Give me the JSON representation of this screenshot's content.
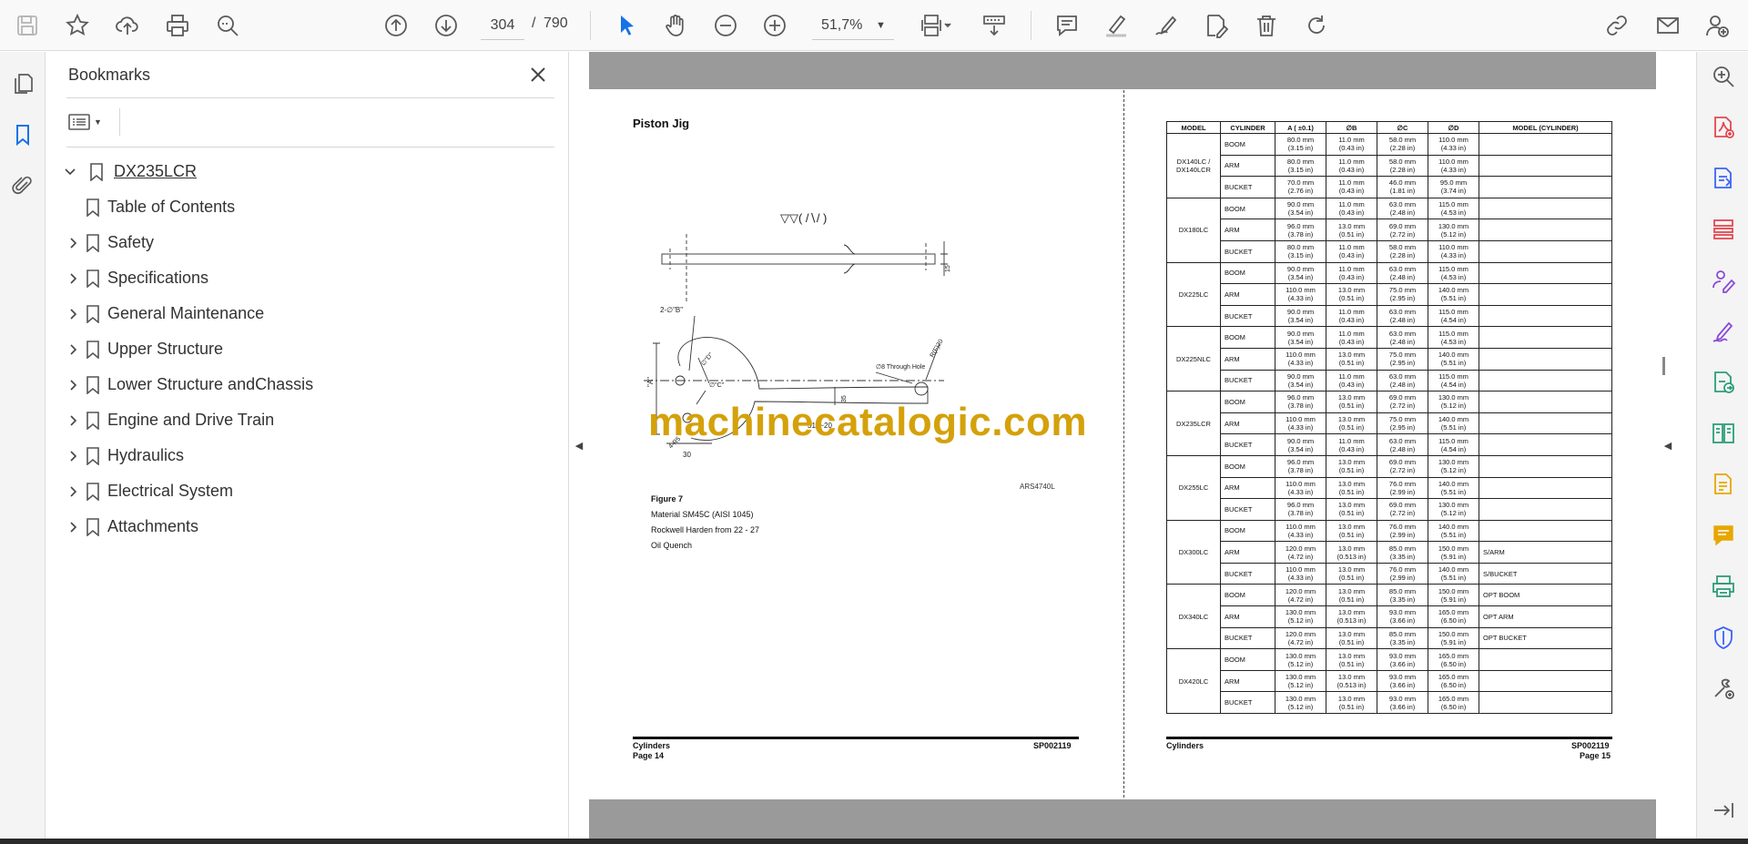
{
  "toolbar": {
    "current_page": "304",
    "page_separator": "/",
    "total_pages": "790",
    "zoom": "51,7%"
  },
  "bookmarks": {
    "title": "Bookmarks",
    "root": "DX235LCR",
    "items": [
      {
        "label": "Table of Contents",
        "expandable": false
      },
      {
        "label": "Safety",
        "expandable": true
      },
      {
        "label": "Specifications",
        "expandable": true
      },
      {
        "label": "General Maintenance",
        "expandable": true
      },
      {
        "label": "Upper Structure",
        "expandable": true
      },
      {
        "label": "Lower Structure andChassis",
        "expandable": true
      },
      {
        "label": "Engine and Drive Train",
        "expandable": true
      },
      {
        "label": "Hydraulics",
        "expandable": true
      },
      {
        "label": "Electrical System",
        "expandable": true
      },
      {
        "label": "Attachments",
        "expandable": true
      }
    ]
  },
  "left_page": {
    "title": "Piston Jig",
    "figure_code": "ARS4740L",
    "figure_caption": "Figure 7",
    "material": "Material SM45C (AISI 1045)",
    "hardness": "Rockwell Harden from 22 - 27",
    "quench": "Oil Quench",
    "dims": {
      "surface": "▽▽( /∖/ )",
      "holes": "2-∅\"B\"",
      "through_hole": "∅8 Through Hole",
      "radius": "R(F)20",
      "a": "\"A\"",
      "c": "∅\"C\"",
      "d": "∅\"D\"",
      "w35": "35",
      "len": "315~20",
      "w30": "30",
      "r5": "4-R5",
      "t15": "15"
    },
    "footer_left": "Cylinders",
    "footer_page": "Page 14",
    "footer_right": "SP002119"
  },
  "watermark": "machinecatalogic.com",
  "right_page": {
    "footer_left": "Cylinders",
    "footer_right": "SP002119",
    "footer_page": "Page 15",
    "table": {
      "headers": [
        "MODEL",
        "CYLINDER",
        "A ( ±0.1)",
        "∅B",
        "∅C",
        "∅D",
        "MODEL (CYLINDER)"
      ],
      "groups": [
        {
          "model": "DX140LC / DX140LCR",
          "rows": [
            {
              "cyl": "BOOM",
              "a": "80.0 mm\n(3.15 in)",
              "b": "11.0 mm\n(0.43 in)",
              "c": "58.0 mm\n(2.28 in)",
              "d": "110.0 mm\n(4.33 in)",
              "mc": ""
            },
            {
              "cyl": "ARM",
              "a": "80.0 mm\n(3.15 in)",
              "b": "11.0 mm\n(0.43 in)",
              "c": "58.0 mm\n(2.28 in)",
              "d": "110.0 mm\n(4.33 in)",
              "mc": ""
            },
            {
              "cyl": "BUCKET",
              "a": "70.0 mm\n(2.76 in)",
              "b": "11.0 mm\n(0.43 in)",
              "c": "46.0 mm\n(1.81 in)",
              "d": "95.0 mm\n(3.74 in)",
              "mc": ""
            }
          ]
        },
        {
          "model": "DX180LC",
          "rows": [
            {
              "cyl": "BOOM",
              "a": "90.0 mm\n(3.54 in)",
              "b": "11.0 mm\n(0.43 in)",
              "c": "63.0 mm\n(2.48 in)",
              "d": "115.0 mm\n(4.53 in)",
              "mc": ""
            },
            {
              "cyl": "ARM",
              "a": "96.0 mm\n(3.78 in)",
              "b": "13.0 mm\n(0.51 in)",
              "c": "69.0 mm\n(2.72 in)",
              "d": "130.0 mm\n(5.12 in)",
              "mc": ""
            },
            {
              "cyl": "BUCKET",
              "a": "80.0 mm\n(3.15 in)",
              "b": "11.0 mm\n(0.43 in)",
              "c": "58.0 mm\n(2.28 in)",
              "d": "110.0 mm\n(4.33 in)",
              "mc": ""
            }
          ]
        },
        {
          "model": "DX225LC",
          "rows": [
            {
              "cyl": "BOOM",
              "a": "90.0 mm\n(3.54 in)",
              "b": "11.0 mm\n(0.43 in)",
              "c": "63.0 mm\n(2.48 in)",
              "d": "115.0 mm\n(4.53 in)",
              "mc": ""
            },
            {
              "cyl": "ARM",
              "a": "110.0 mm\n(4.33 in)",
              "b": "13.0 mm\n(0.51 in)",
              "c": "75.0 mm\n(2.95 in)",
              "d": "140.0 mm\n(5.51 in)",
              "mc": ""
            },
            {
              "cyl": "BUCKET",
              "a": "90.0 mm\n(3.54 in)",
              "b": "11.0 mm\n(0.43 in)",
              "c": "63.0 mm\n(2.48 in)",
              "d": "115.0 mm\n(4.54 in)",
              "mc": ""
            }
          ]
        },
        {
          "model": "DX225NLC",
          "rows": [
            {
              "cyl": "BOOM",
              "a": "90.0 mm\n(3.54 in)",
              "b": "11.0 mm\n(0.43 in)",
              "c": "63.0 mm\n(2.48 in)",
              "d": "115.0 mm\n(4.53 in)",
              "mc": ""
            },
            {
              "cyl": "ARM",
              "a": "110.0 mm\n(4.33 in)",
              "b": "13.0 mm\n(0.51 in)",
              "c": "75.0 mm\n(2.95 in)",
              "d": "140.0 mm\n(5.51 in)",
              "mc": ""
            },
            {
              "cyl": "BUCKET",
              "a": "90.0 mm\n(3.54 in)",
              "b": "11.0 mm\n(0.43 in)",
              "c": "63.0 mm\n(2.48 in)",
              "d": "115.0 mm\n(4.54 in)",
              "mc": ""
            }
          ]
        },
        {
          "model": "DX235LCR",
          "rows": [
            {
              "cyl": "BOOM",
              "a": "96.0 mm\n(3.78 in)",
              "b": "13.0 mm\n(0.51 in)",
              "c": "69.0 mm\n(2.72 in)",
              "d": "130.0 mm\n(5.12 in)",
              "mc": ""
            },
            {
              "cyl": "ARM",
              "a": "110.0 mm\n(4.33 in)",
              "b": "13.0 mm\n(0.51 in)",
              "c": "75.0 mm\n(2.95 in)",
              "d": "140.0 mm\n(5.51 in)",
              "mc": ""
            },
            {
              "cyl": "BUCKET",
              "a": "90.0 mm\n(3.54 in)",
              "b": "11.0 mm\n(0.43 in)",
              "c": "63.0 mm\n(2.48 in)",
              "d": "115.0 mm\n(4.54 in)",
              "mc": ""
            }
          ]
        },
        {
          "model": "DX255LC",
          "rows": [
            {
              "cyl": "BOOM",
              "a": "96.0 mm\n(3.78 in)",
              "b": "13.0 mm\n(0.51 in)",
              "c": "69.0 mm\n(2.72 in)",
              "d": "130.0 mm\n(5.12 in)",
              "mc": ""
            },
            {
              "cyl": "ARM",
              "a": "110.0 mm\n(4.33 in)",
              "b": "13.0 mm\n(0.51 in)",
              "c": "76.0 mm\n(2.99 in)",
              "d": "140.0 mm\n(5.51 in)",
              "mc": ""
            },
            {
              "cyl": "BUCKET",
              "a": "96.0 mm\n(3.78 in)",
              "b": "13.0 mm\n(0.51 in)",
              "c": "69.0 mm\n(2.72 in)",
              "d": "130.0 mm\n(5.12 in)",
              "mc": ""
            }
          ]
        },
        {
          "model": "DX300LC",
          "rows": [
            {
              "cyl": "BOOM",
              "a": "110.0 mm\n(4.33 in)",
              "b": "13.0 mm\n(0.51 in)",
              "c": "76.0 mm\n(2.99 in)",
              "d": "140.0 mm\n(5.51 in)",
              "mc": ""
            },
            {
              "cyl": "ARM",
              "a": "120.0 mm\n(4.72 in)",
              "b": "13.0 mm\n(0.513 in)",
              "c": "85.0 mm\n(3.35 in)",
              "d": "150.0 mm\n(5.91 in)",
              "mc": "S/ARM"
            },
            {
              "cyl": "BUCKET",
              "a": "110.0 mm\n(4.33 in)",
              "b": "13.0 mm\n(0.51 in)",
              "c": "76.0 mm\n(2.99 in)",
              "d": "140.0 mm\n(5.51 in)",
              "mc": "S/BUCKET"
            }
          ]
        },
        {
          "model": "DX340LC",
          "rows": [
            {
              "cyl": "BOOM",
              "a": "120.0 mm\n(4.72 in)",
              "b": "13.0 mm\n(0.51 in)",
              "c": "85.0 mm\n(3.35 in)",
              "d": "150.0 mm\n(5.91 in)",
              "mc": "OPT BOOM"
            },
            {
              "cyl": "ARM",
              "a": "130.0 mm\n(5.12 in)",
              "b": "13.0 mm\n(0.513 in)",
              "c": "93.0 mm\n(3.66 in)",
              "d": "165.0 mm\n(6.50 in)",
              "mc": "OPT ARM"
            },
            {
              "cyl": "BUCKET",
              "a": "120.0 mm\n(4.72 in)",
              "b": "13.0 mm\n(0.51 in)",
              "c": "85.0 mm\n(3.35 in)",
              "d": "150.0 mm\n(5.91 in)",
              "mc": "OPT BUCKET"
            }
          ]
        },
        {
          "model": "DX420LC",
          "rows": [
            {
              "cyl": "BOOM",
              "a": "130.0 mm\n(5.12 in)",
              "b": "13.0 mm\n(0.51 in)",
              "c": "93.0 mm\n(3.66 in)",
              "d": "165.0 mm\n(6.50 in)",
              "mc": ""
            },
            {
              "cyl": "ARM",
              "a": "130.0 mm\n(5.12 in)",
              "b": "13.0 mm\n(0.513 in)",
              "c": "93.0 mm\n(3.66 in)",
              "d": "165.0 mm\n(6.50 in)",
              "mc": ""
            },
            {
              "cyl": "BUCKET",
              "a": "130.0 mm\n(5.12 in)",
              "b": "13.0 mm\n(0.51 in)",
              "c": "93.0 mm\n(3.66 in)",
              "d": "165.0 mm\n(6.50 in)",
              "mc": ""
            }
          ]
        }
      ]
    }
  },
  "colors": {
    "accent_blue": "#1473e6",
    "icon_grey": "#5a5a5a",
    "watermark": "#d4a10a",
    "rail_red": "#e34850",
    "rail_purple": "#8a4ad8",
    "rail_green": "#2d9d78",
    "rail_yellow": "#e8a700"
  },
  "icons": {
    "toolbar": [
      "save-icon",
      "star-icon",
      "upload-icon",
      "print-icon",
      "zoom-search-icon",
      "prev-page-icon",
      "next-page-icon",
      "select-cursor-icon",
      "hand-icon",
      "zoom-out-icon",
      "zoom-in-icon",
      "page-fit-icon",
      "scroll-mode-icon",
      "comment-icon",
      "highlight-icon",
      "sign-icon",
      "fill-sign-icon",
      "delete-icon",
      "rotate-icon",
      "link-icon",
      "email-icon",
      "account-icon"
    ],
    "right_rail": [
      "search-zoom-icon",
      "create-pdf-icon",
      "export-pdf-icon",
      "organize-pages-icon",
      "request-signature-icon",
      "fill-sign-icon",
      "send-for-review-icon",
      "compare-icon",
      "edit-pdf-icon",
      "comment-icon",
      "scan-icon",
      "protect-icon",
      "more-tools-icon",
      "collapse-rail-icon"
    ]
  }
}
